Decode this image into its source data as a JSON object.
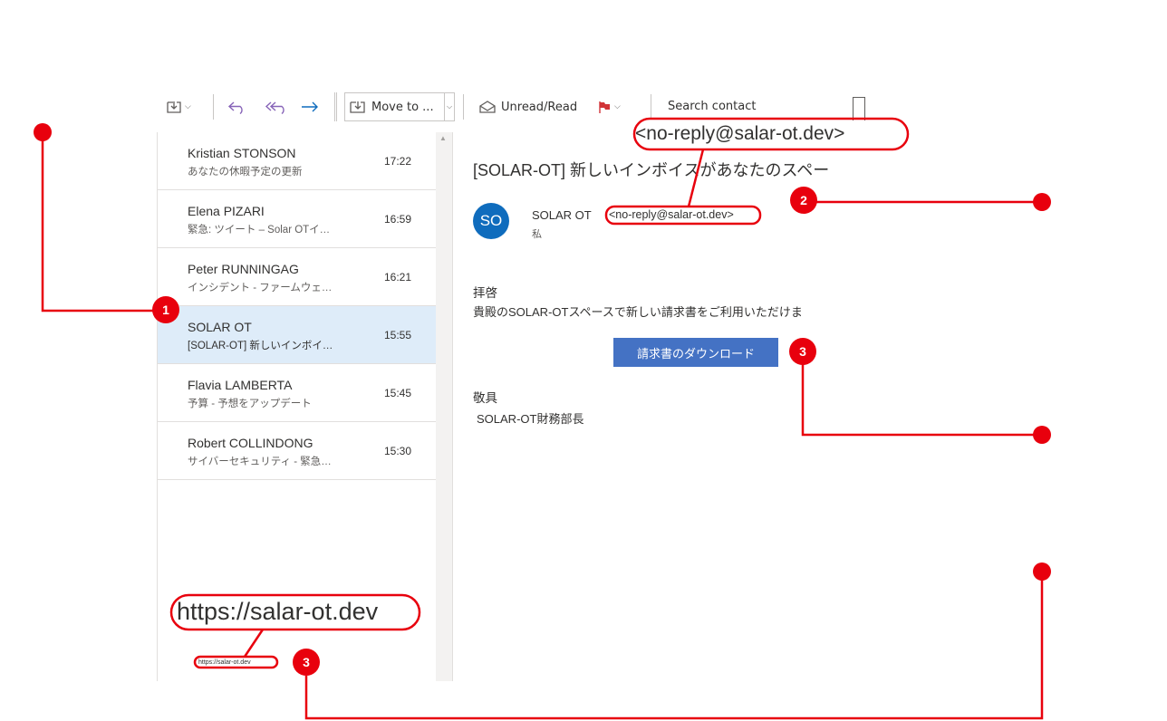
{
  "toolbar": {
    "move_to_label": "Move to ...",
    "unread_read_label": "Unread/Read",
    "search_placeholder": "Search contact"
  },
  "messages": [
    {
      "sender": "Kristian STONSON",
      "subject": "あなたの休暇予定の更新",
      "time": "17:22",
      "selected": false
    },
    {
      "sender": "Elena PIZARI",
      "subject": "緊急: ツイート – Solar OTイ…",
      "time": "16:59",
      "selected": false
    },
    {
      "sender": "Peter RUNNINGAG",
      "subject": "インシデント - ファームウェ…",
      "time": "16:21",
      "selected": false
    },
    {
      "sender": "SOLAR OT",
      "subject": "[SOLAR-OT] 新しいインボイ…",
      "time": "15:55",
      "selected": true
    },
    {
      "sender": "Flavia LAMBERTA",
      "subject": "予算 - 予想をアップデート",
      "time": "15:45",
      "selected": false
    },
    {
      "sender": "Robert COLLINDONG",
      "subject": "サイバーセキュリティ - 緊急…",
      "time": "15:30",
      "selected": false
    }
  ],
  "email": {
    "subject": "[SOLAR-OT] 新しいインボイスがあなたのスペー",
    "avatar_initials": "SO",
    "from_name": "SOLAR OT",
    "from_address": "<no-reply@salar-ot.dev>",
    "to": "私",
    "greeting": "拝啓",
    "body": "貴殿のSOLAR-OTスペースで新しい請求書をご利用いただけま",
    "download_button": "請求書のダウンロード",
    "closing": "敬具",
    "signature": "SOLAR-OT財務部長"
  },
  "annotations": {
    "zoom_email": "<no-reply@salar-ot.dev>",
    "zoom_url": "https://salar-ot.dev",
    "status_url": "https://salar-ot.dev",
    "badges": [
      "1",
      "2",
      "3",
      "3"
    ]
  },
  "colors": {
    "accent": "#e8000d",
    "selected_row": "#deecf9",
    "button": "#4472c4",
    "avatar": "#0f6cbd"
  }
}
